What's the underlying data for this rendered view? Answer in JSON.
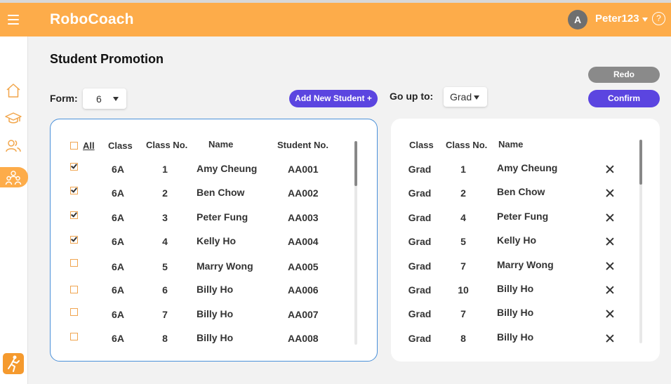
{
  "header": {
    "brand": "RoboCoach",
    "avatar_initial": "A",
    "username": "Peter123",
    "help_icon": "?"
  },
  "page": {
    "title": "Student Promotion"
  },
  "controls": {
    "form_label": "Form:",
    "form_value": "6",
    "go_up_label": "Go up to:",
    "go_up_value": "Grad",
    "add_student_label": "Add New Student +",
    "redo_label": "Redo",
    "confirm_label": "Confirm"
  },
  "left_table": {
    "select_all_label": "All",
    "headers": {
      "class": "Class",
      "class_no": "Class No.",
      "name": "Name",
      "student_no": "Student No."
    },
    "rows": [
      {
        "checked": true,
        "class": "6A",
        "class_no": "1",
        "name": "Amy Cheung",
        "student_no": "AA001"
      },
      {
        "checked": true,
        "class": "6A",
        "class_no": "2",
        "name": "Ben Chow",
        "student_no": "AA002"
      },
      {
        "checked": true,
        "class": "6A",
        "class_no": "3",
        "name": "Peter Fung",
        "student_no": "AA003"
      },
      {
        "checked": true,
        "class": "6A",
        "class_no": "4",
        "name": "Kelly Ho",
        "student_no": "AA004"
      },
      {
        "checked": false,
        "class": "6A",
        "class_no": "5",
        "name": "Marry Wong",
        "student_no": "AA005"
      },
      {
        "checked": false,
        "class": "6A",
        "class_no": "6",
        "name": "Billy Ho",
        "student_no": "AA006"
      },
      {
        "checked": false,
        "class": "6A",
        "class_no": "7",
        "name": "Billy Ho",
        "student_no": "AA007"
      },
      {
        "checked": false,
        "class": "6A",
        "class_no": "8",
        "name": "Billy Ho",
        "student_no": "AA008"
      }
    ]
  },
  "right_table": {
    "headers": {
      "class": "Class",
      "class_no": "Class No.",
      "name": "Name"
    },
    "rows": [
      {
        "class": "Grad",
        "class_no": "1",
        "name": "Amy Cheung"
      },
      {
        "class": "Grad",
        "class_no": "2",
        "name": "Ben Chow"
      },
      {
        "class": "Grad",
        "class_no": "4",
        "name": "Peter Fung"
      },
      {
        "class": "Grad",
        "class_no": "5",
        "name": "Kelly Ho"
      },
      {
        "class": "Grad",
        "class_no": "7",
        "name": "Marry Wong"
      },
      {
        "class": "Grad",
        "class_no": "10",
        "name": "Billy Ho"
      },
      {
        "class": "Grad",
        "class_no": "7",
        "name": "Billy Ho"
      },
      {
        "class": "Grad",
        "class_no": "8",
        "name": "Billy Ho"
      }
    ]
  },
  "sidebar": {
    "items": [
      {
        "icon": "home-icon"
      },
      {
        "icon": "graduation-cap-icon"
      },
      {
        "icon": "users-icon"
      },
      {
        "icon": "student-group-icon",
        "active": true
      }
    ],
    "bottom_icon": "runner-logo-icon"
  },
  "colors": {
    "accent": "#fdac4a",
    "button": "#5b45e0",
    "button_disabled": "#8a8a8a",
    "panel_border": "#4a90d9"
  }
}
